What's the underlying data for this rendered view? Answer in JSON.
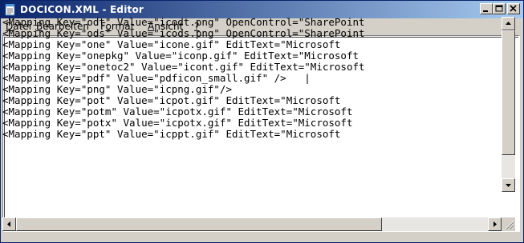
{
  "window": {
    "title": "DOCICON.XML - Editor"
  },
  "menu": {
    "items": [
      {
        "first": "D",
        "rest": "atei"
      },
      {
        "first": "B",
        "rest": "earbeiten"
      },
      {
        "pre": "F",
        "first": "o",
        "rest": "rmat"
      },
      {
        "first": "A",
        "rest": "nsicht"
      },
      {
        "first": "?",
        "rest": ""
      }
    ]
  },
  "editor": {
    "lines": [
      "<Mapping Key=\"odt\" Value=\"icodt.png\" OpenControl=\"SharePoint",
      "<Mapping Key=\"ods\" Value=\"icods.png\" OpenControl=\"SharePoint",
      "<Mapping Key=\"one\" Value=\"icone.gif\" EditText=\"Microsoft",
      "<Mapping Key=\"onepkg\" Value=\"iconp.gif\" EditText=\"Microsoft",
      "<Mapping Key=\"onetoc2\" Value=\"icont.gif\" EditText=\"Microsoft",
      "<Mapping Key=\"pdf\" Value=\"pdficon_small.gif\" />   |",
      "<Mapping Key=\"png\" Value=\"icpng.gif\"/>",
      "<Mapping Key=\"pot\" Value=\"icpot.gif\" EditText=\"Microsoft",
      "<Mapping Key=\"potm\" Value=\"icpotx.gif\" EditText=\"Microsoft",
      "<Mapping Key=\"potx\" Value=\"icpotx.gif\" EditText=\"Microsoft",
      "<Mapping Key=\"ppt\" Value=\"icppt.gif\" EditText=\"Microsoft"
    ]
  },
  "colors": {
    "titlebar_start": "#0a246a",
    "titlebar_end": "#a6caf0",
    "chrome": "#d4d0c8"
  },
  "icons": {
    "app": "notepad-icon",
    "minimize": "minimize-icon",
    "maximize": "maximize-icon",
    "close": "close-icon"
  }
}
